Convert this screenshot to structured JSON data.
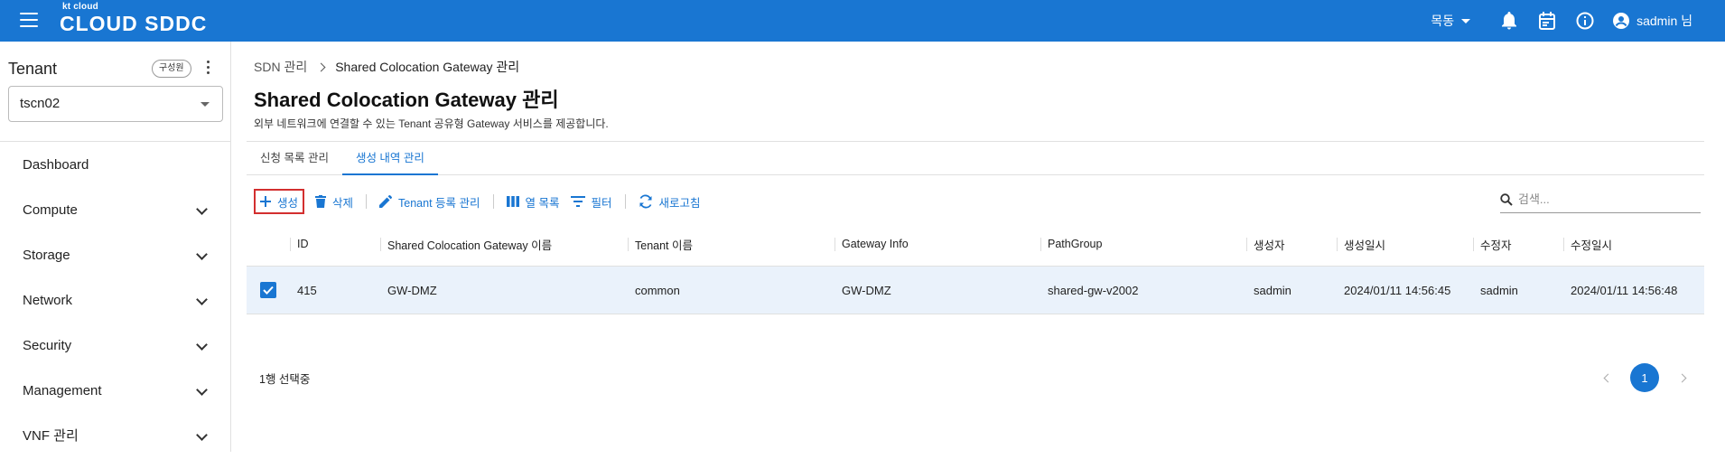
{
  "topbar": {
    "brand_small": "kt cloud",
    "brand_big": "CLOUD SDDC",
    "region": "목동",
    "user_name": "sadmin 님"
  },
  "sidebar": {
    "tenant_label": "Tenant",
    "member_chip": "구성원",
    "tenant_value": "tscn02",
    "items": [
      {
        "label": "Dashboard",
        "expandable": false
      },
      {
        "label": "Compute",
        "expandable": true
      },
      {
        "label": "Storage",
        "expandable": true
      },
      {
        "label": "Network",
        "expandable": true
      },
      {
        "label": "Security",
        "expandable": true
      },
      {
        "label": "Management",
        "expandable": true
      },
      {
        "label": "VNF 관리",
        "expandable": true
      }
    ]
  },
  "breadcrumb": {
    "parent": "SDN 관리",
    "current": "Shared Colocation Gateway 관리"
  },
  "page": {
    "title": "Shared Colocation Gateway 관리",
    "description": "외부 네트워크에 연결할 수 있는 Tenant 공유형 Gateway 서비스를 제공합니다."
  },
  "tabs": [
    {
      "label": "신청 목록 관리",
      "active": false
    },
    {
      "label": "생성 내역 관리",
      "active": true
    }
  ],
  "toolbar": {
    "create": "생성",
    "delete": "삭제",
    "tenant_register": "Tenant 등록 관리",
    "columns": "열 목록",
    "filter": "필터",
    "refresh": "새로고침"
  },
  "search": {
    "placeholder": "검색..."
  },
  "table": {
    "headers": {
      "id": "ID",
      "gw_name": "Shared Colocation Gateway 이름",
      "tenant": "Tenant 이름",
      "gw_info": "Gateway Info",
      "pathgroup": "PathGroup",
      "creator": "생성자",
      "created": "생성일시",
      "modifier": "수정자",
      "modified": "수정일시"
    },
    "rows": [
      {
        "selected": true,
        "id": "415",
        "gw_name": "GW-DMZ",
        "tenant": "common",
        "gw_info": "GW-DMZ",
        "pathgroup": "shared-gw-v2002",
        "creator": "sadmin",
        "created": "2024/01/11 14:56:45",
        "modifier": "sadmin",
        "modified": "2024/01/11 14:56:48"
      }
    ]
  },
  "footer": {
    "selection": "1행 선택중",
    "current_page": "1"
  },
  "colors": {
    "primary": "#1976d2",
    "highlight_border": "#d32f2f",
    "selected_row": "#eaf2fb"
  }
}
